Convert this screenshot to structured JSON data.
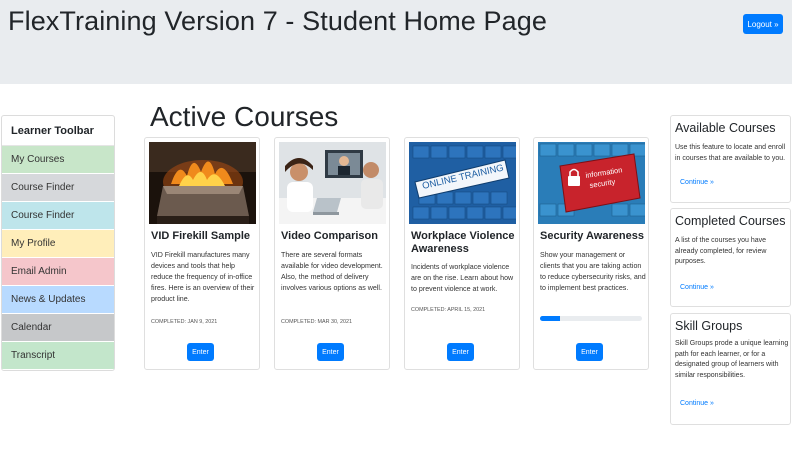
{
  "header": {
    "title": "FlexTraining Version 7 - Student Home Page",
    "logout_label": "Logout »"
  },
  "sidebar": {
    "title": "Learner Toolbar",
    "items": [
      {
        "label": "My Courses",
        "color": "#c8e6c9"
      },
      {
        "label": "Course Finder",
        "color": "#d6d8db"
      },
      {
        "label": "Course Finder",
        "color": "#bee5eb"
      },
      {
        "label": "My Profile",
        "color": "#ffeeba"
      },
      {
        "label": "Email Admin",
        "color": "#f5c6cb"
      },
      {
        "label": "News & Updates",
        "color": "#b8daff"
      },
      {
        "label": "Calendar",
        "color": "#c6c8ca"
      },
      {
        "label": "Transcript",
        "color": "#c3e6cb"
      }
    ]
  },
  "main": {
    "title": "Active Courses",
    "courses": [
      {
        "title": "VID Firekill Sample",
        "description": "VID Firekill manufactures many devices and tools that help reduce the frequency of in-office fires. Here is an overview of their product line.",
        "completed": "COMPLETED: JAN 9, 2021",
        "button": "Enter"
      },
      {
        "title": "Video Comparison",
        "description": "There are several formats available for video development. Also, the method of delivery involves various options as well.",
        "completed": "COMPLETED: MAR 30, 2021",
        "button": "Enter"
      },
      {
        "title": "Workplace Violence Awareness",
        "description": "Incidents of workplace violence are on the rise. Learn about how to prevent violence at work.",
        "completed": "COMPLETED: APRIL 15, 2021",
        "image_text": "ONLINE TRAINING",
        "button": "Enter"
      },
      {
        "title": "Security Awareness",
        "description": "Show your management or clients that you are taking action to reduce cybersecurity risks, and to implement best practices.",
        "progress_percent": 20,
        "image_text_1": "information",
        "image_text_2": "security",
        "button": "Enter"
      }
    ]
  },
  "panels": [
    {
      "title": "Available Courses",
      "text": "Use this feature to locate and enroll in courses that are available to you.",
      "link": "Continue »"
    },
    {
      "title": "Completed Courses",
      "text": "A list of the courses you have already completed, for review purposes.",
      "link": "Continue »"
    },
    {
      "title": "Skill Groups",
      "text": "Skill Groups prode a unique learning path for each learner, or for a designated group of learners with similar responsibilities.",
      "link": "Continue »"
    }
  ],
  "colors": {
    "primary": "#007bff",
    "header_bg": "#e9ecef"
  }
}
